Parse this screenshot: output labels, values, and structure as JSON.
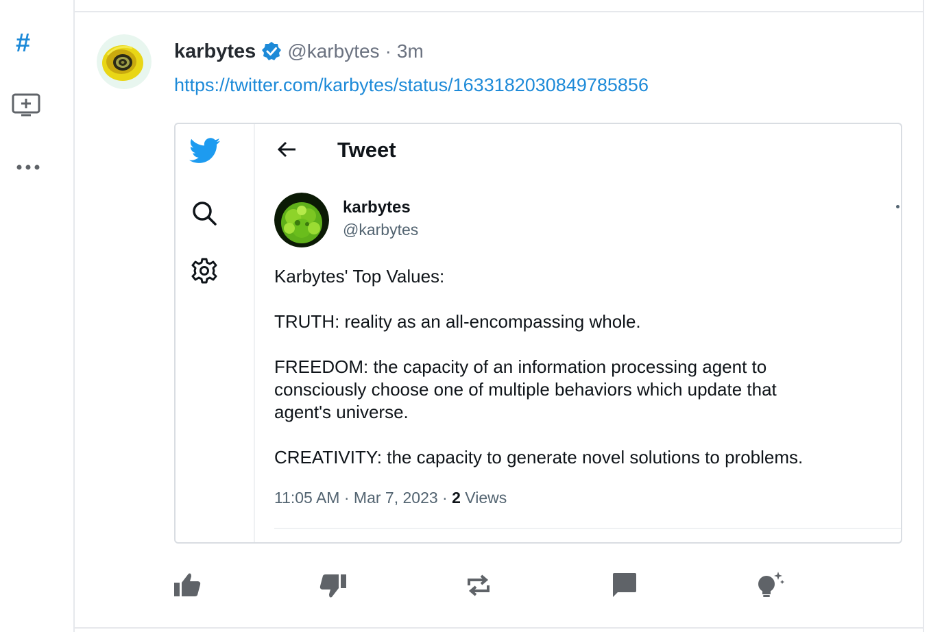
{
  "rail": {
    "hashtag": "#",
    "items": [
      {
        "icon": "hashtag-icon"
      },
      {
        "icon": "new-post-icon"
      },
      {
        "icon": "more-icon"
      }
    ]
  },
  "post": {
    "author_name": "karbytes",
    "verified": true,
    "handle": "@karbytes",
    "separator": "·",
    "time": "3m",
    "link": "https://twitter.com/karbytes/status/1633182030849785856",
    "actions": [
      "like-icon",
      "dislike-icon",
      "repost-icon",
      "comment-icon",
      "insight-icon"
    ]
  },
  "embed": {
    "page_title": "Tweet",
    "author_name": "karbytes",
    "handle": "@karbytes",
    "paragraphs": [
      "Karbytes' Top Values:",
      "TRUTH: reality as an all-encompassing whole.",
      "FREEDOM: the capacity of an information processing agent to\nconsciously choose one of multiple behaviors which update that\nagent's universe.",
      "CREATIVITY: the capacity to generate novel solutions to problems."
    ],
    "timestamp": "11:05 AM · Mar 7, 2023 · ",
    "views_count": "2",
    "views_label": " Views"
  },
  "colors": {
    "accent": "#1d8ad8",
    "twitter_blue": "#1d9bf0",
    "icon_gray": "#5f6368"
  }
}
